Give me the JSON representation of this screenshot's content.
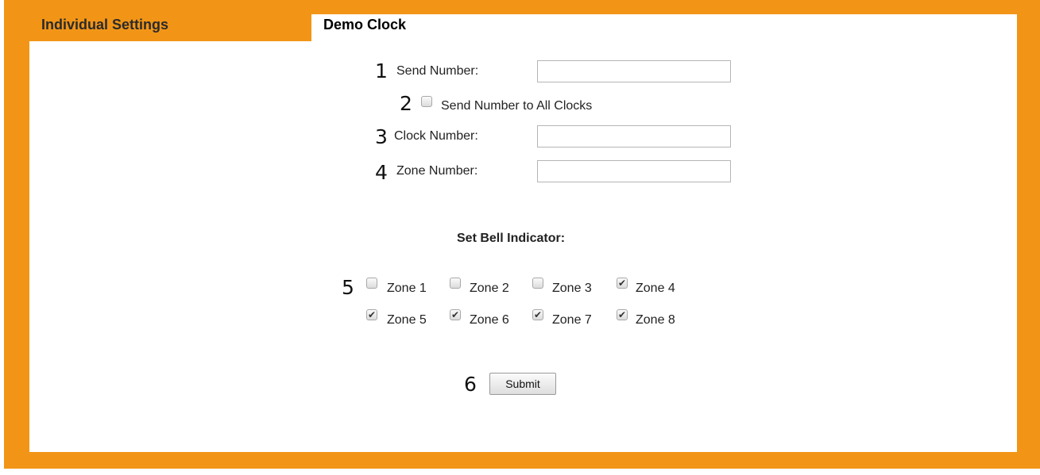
{
  "tabs": {
    "individual_settings": "Individual Settings",
    "demo_clock": "Demo Clock"
  },
  "markers": [
    "1",
    "2",
    "3",
    "4",
    "5",
    "6"
  ],
  "form": {
    "send_number_label": "Send Number:",
    "send_number_value": "",
    "send_all_label": "Send Number to All Clocks",
    "send_all_checked": false,
    "clock_number_label": "Clock Number:",
    "clock_number_value": "",
    "zone_number_label": "Zone Number:",
    "zone_number_value": ""
  },
  "bell": {
    "heading": "Set Bell Indicator:",
    "zones": [
      {
        "label": "Zone 1",
        "checked": false
      },
      {
        "label": "Zone 2",
        "checked": false
      },
      {
        "label": "Zone 3",
        "checked": false
      },
      {
        "label": "Zone 4",
        "checked": true
      },
      {
        "label": "Zone 5",
        "checked": true
      },
      {
        "label": "Zone 6",
        "checked": true
      },
      {
        "label": "Zone 7",
        "checked": true
      },
      {
        "label": "Zone 8",
        "checked": true
      }
    ]
  },
  "submit_label": "Submit",
  "colors": {
    "frame": "#f29517",
    "panel": "#ffffff"
  }
}
